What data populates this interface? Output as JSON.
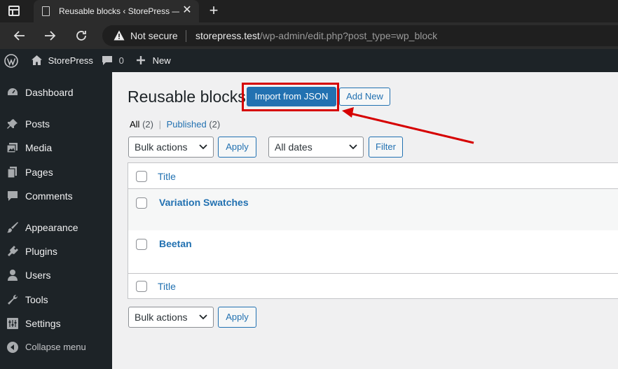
{
  "browser": {
    "tab_title": "Reusable blocks ‹ StorePress — WordPress",
    "tab_close": "✕",
    "new_tab": "+",
    "security_label": "Not secure",
    "url_host": "storepress.test",
    "url_path": "/wp-admin/edit.php?post_type=wp_block"
  },
  "adminbar": {
    "site_name": "StorePress",
    "comments_count": "0",
    "new_label": "New"
  },
  "sidebar": {
    "items": [
      {
        "label": "Dashboard",
        "icon": "dashboard-icon"
      },
      {
        "label": "Posts",
        "icon": "pin-icon"
      },
      {
        "label": "Media",
        "icon": "media-icon"
      },
      {
        "label": "Pages",
        "icon": "pages-icon"
      },
      {
        "label": "Comments",
        "icon": "comment-icon"
      },
      {
        "label": "Appearance",
        "icon": "brush-icon"
      },
      {
        "label": "Plugins",
        "icon": "plug-icon"
      },
      {
        "label": "Users",
        "icon": "user-icon"
      },
      {
        "label": "Tools",
        "icon": "wrench-icon"
      },
      {
        "label": "Settings",
        "icon": "settings-icon"
      },
      {
        "label": "Collapse menu",
        "icon": "collapse-icon"
      }
    ]
  },
  "main": {
    "page_title": "Reusable blocks",
    "import_button": "Import from JSON",
    "add_new_button": "Add New",
    "filters": {
      "all_label": "All",
      "all_count": "(2)",
      "separator": "|",
      "published_label": "Published",
      "published_count": "(2)"
    },
    "bulk_actions": "Bulk actions",
    "apply": "Apply",
    "dates": "All dates",
    "filter": "Filter",
    "column_title": "Title",
    "rows": [
      {
        "title": "Variation Swatches"
      },
      {
        "title": "Beetan"
      }
    ]
  },
  "colors": {
    "accent": "#2271b1",
    "highlight": "#d60000",
    "adminbar": "#1d2327"
  }
}
